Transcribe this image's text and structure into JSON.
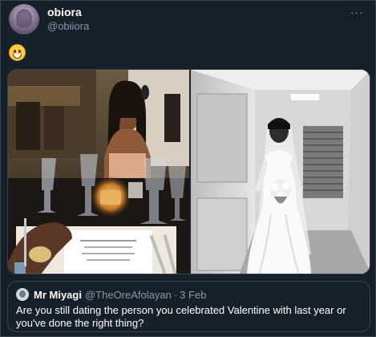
{
  "tweet": {
    "display_name": "obiora",
    "handle": "@obiiora",
    "more_icon": "···",
    "emoji": "grinning-face-with-smiling-eyes"
  },
  "quoted": {
    "display_name": "Mr Miyagi",
    "handle": "@TheOreAfolayan",
    "separator": "·",
    "date": "3 Feb",
    "text": "Are you still dating the person you  celebrated Valentine with last year or you've done the right thing?"
  },
  "colors": {
    "background": "#15202b",
    "border": "#38444d",
    "secondary_text": "#8899a6"
  }
}
